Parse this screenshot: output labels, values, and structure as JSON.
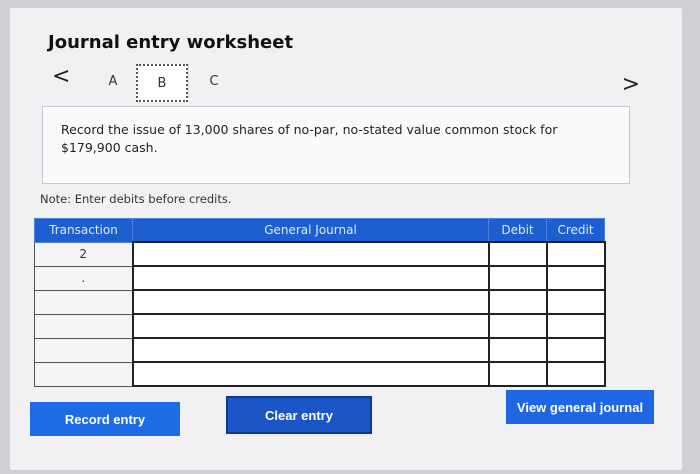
{
  "worksheet": {
    "title": "Journal entry worksheet",
    "tabs": [
      {
        "label": "A"
      },
      {
        "label": "B"
      },
      {
        "label": "C"
      }
    ],
    "nav_prev": "<",
    "nav_next": ">",
    "prompt": "Record the issue of 13,000 shares of no-par, no-stated value common stock for $179,900 cash.",
    "note": "Note: Enter debits before credits."
  },
  "journal_table": {
    "headers": {
      "transaction": "Transaction",
      "general_journal": "General Journal",
      "debit": "Debit",
      "credit": "Credit"
    },
    "rows": [
      {
        "transaction": "2",
        "account": "",
        "debit": "",
        "credit": ""
      },
      {
        "transaction": ".",
        "account": "",
        "debit": "",
        "credit": ""
      },
      {
        "transaction": "",
        "account": "",
        "debit": "",
        "credit": ""
      },
      {
        "transaction": "",
        "account": "",
        "debit": "",
        "credit": ""
      },
      {
        "transaction": "",
        "account": "",
        "debit": "",
        "credit": ""
      },
      {
        "transaction": "",
        "account": "",
        "debit": "",
        "credit": ""
      }
    ]
  },
  "buttons": {
    "record_entry": "Record entry",
    "clear_entry": "Clear entry",
    "view_general_journal": "View general journal"
  }
}
